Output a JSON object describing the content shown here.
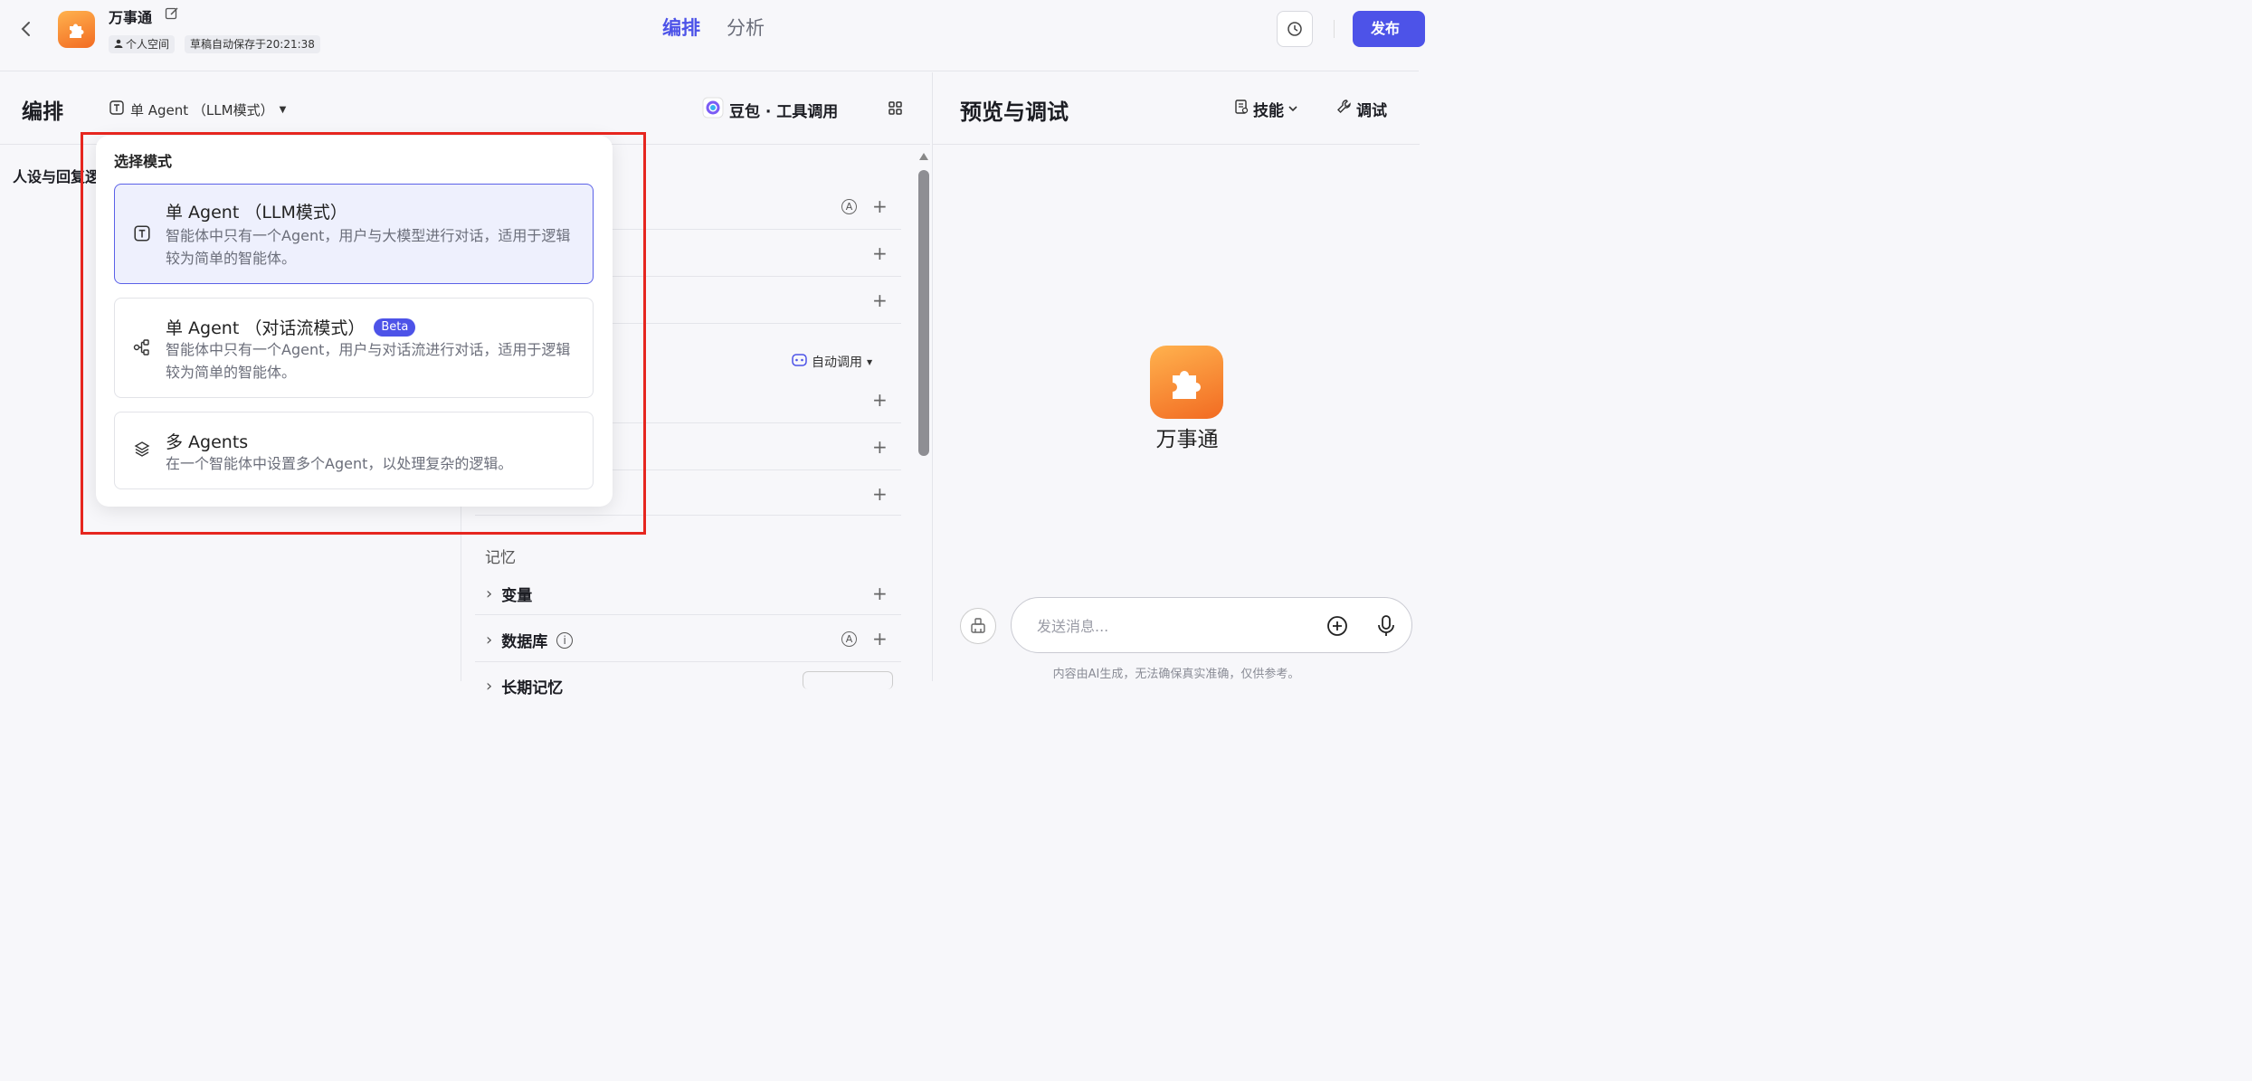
{
  "topbar": {
    "app_title": "万事通",
    "tag_space": "个人空间",
    "tag_autosave": "草稿自动保存于20:21:38",
    "tabs": [
      {
        "label": "编排"
      },
      {
        "label": "分析"
      }
    ],
    "publish_label": "发布"
  },
  "editor": {
    "title": "编排",
    "mode_label": "单 Agent （LLM模式）",
    "model_label": "豆包 · 工具调用",
    "persona_title": "人设与回复逻辑",
    "auto_call_label": "自动调用",
    "memory_title": "记忆",
    "memory_items": [
      {
        "label": "变量"
      },
      {
        "label": "数据库"
      },
      {
        "label": "长期记忆"
      }
    ]
  },
  "dropdown": {
    "heading": "选择模式",
    "options": [
      {
        "title": "单 Agent （LLM模式）",
        "desc": "智能体中只有一个Agent，用户与大模型进行对话，适用于逻辑较为简单的智能体。",
        "selected": true
      },
      {
        "title": "单 Agent （对话流模式）",
        "badge": "Beta",
        "desc": "智能体中只有一个Agent，用户与对话流进行对话，适用于逻辑较为简单的智能体。",
        "selected": false
      },
      {
        "title": "多 Agents",
        "desc": "在一个智能体中设置多个Agent，以处理复杂的逻辑。",
        "selected": false
      }
    ]
  },
  "preview": {
    "title": "预览与调试",
    "skill_label": "技能",
    "debug_label": "调试",
    "bot_name": "万事通",
    "input_placeholder": "发送消息...",
    "disclaimer": "内容由AI生成，无法确保真实准确，仅供参考。"
  },
  "colors": {
    "accent": "#4d53e8",
    "highlight": "#e6261f",
    "app_icon": "#f5842f"
  }
}
